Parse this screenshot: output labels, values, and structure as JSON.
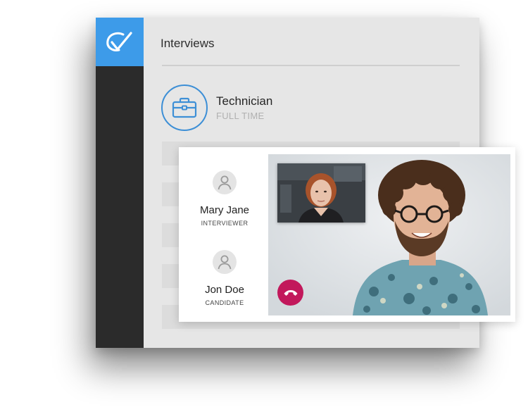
{
  "app": {
    "section_title": "Interviews",
    "brand_color": "#3d9be9",
    "logo_icon": "checkmark-logo-icon"
  },
  "job": {
    "title": "Technician",
    "type": "FULL TIME",
    "icon": "briefcase-icon",
    "accent_color": "#3d8fd6"
  },
  "call": {
    "participants": [
      {
        "name": "Mary Jane",
        "role": "INTERVIEWER",
        "icon": "user-avatar-icon"
      },
      {
        "name": "Jon Doe",
        "role": "CANDIDATE",
        "icon": "user-avatar-icon"
      }
    ],
    "hangup_icon": "phone-hangup-icon",
    "hangup_color": "#c2185b"
  }
}
